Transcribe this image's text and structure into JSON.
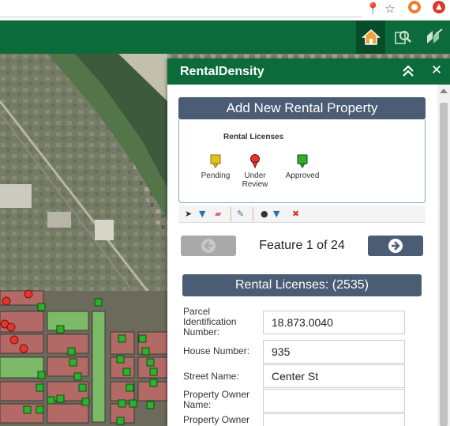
{
  "browser": {
    "icons": [
      "pin-icon",
      "star-icon",
      "extension-orange-icon",
      "extension-red-icon"
    ]
  },
  "header": {
    "buttons": [
      "home-icon",
      "search-icon",
      "layers-icon"
    ],
    "brand_color": "#0b6b3a"
  },
  "panel": {
    "title": "RentalDensity",
    "add_button_label": "Add New Rental Property",
    "template": {
      "title": "Rental Licenses",
      "items": [
        {
          "label": "Pending",
          "color": "#e3c21c"
        },
        {
          "label": "Under Review",
          "color": "#e3342f"
        },
        {
          "label": "Approved",
          "color": "#2fae2f"
        }
      ]
    },
    "toolbar": [
      "select-arrow-icon",
      "dropdown-icon",
      "eraser-icon",
      "attributes-icon",
      "point-tool-icon",
      "dropdown-icon",
      "delete-icon"
    ],
    "feature_nav": "Feature 1 of 24",
    "layer_header": "Rental Licenses: (2535)",
    "attributes": [
      {
        "label": "Parcel Identification Number:",
        "value": "18.873.0040"
      },
      {
        "label": "House Number:",
        "value": "935"
      },
      {
        "label": "Street Name:",
        "value": "Center St"
      },
      {
        "label": "Property Owner Name:",
        "value": ""
      },
      {
        "label": "Property Owner",
        "value": ""
      }
    ]
  },
  "colors": {
    "accent": "#4a5d74",
    "header": "#0b6b3a"
  }
}
